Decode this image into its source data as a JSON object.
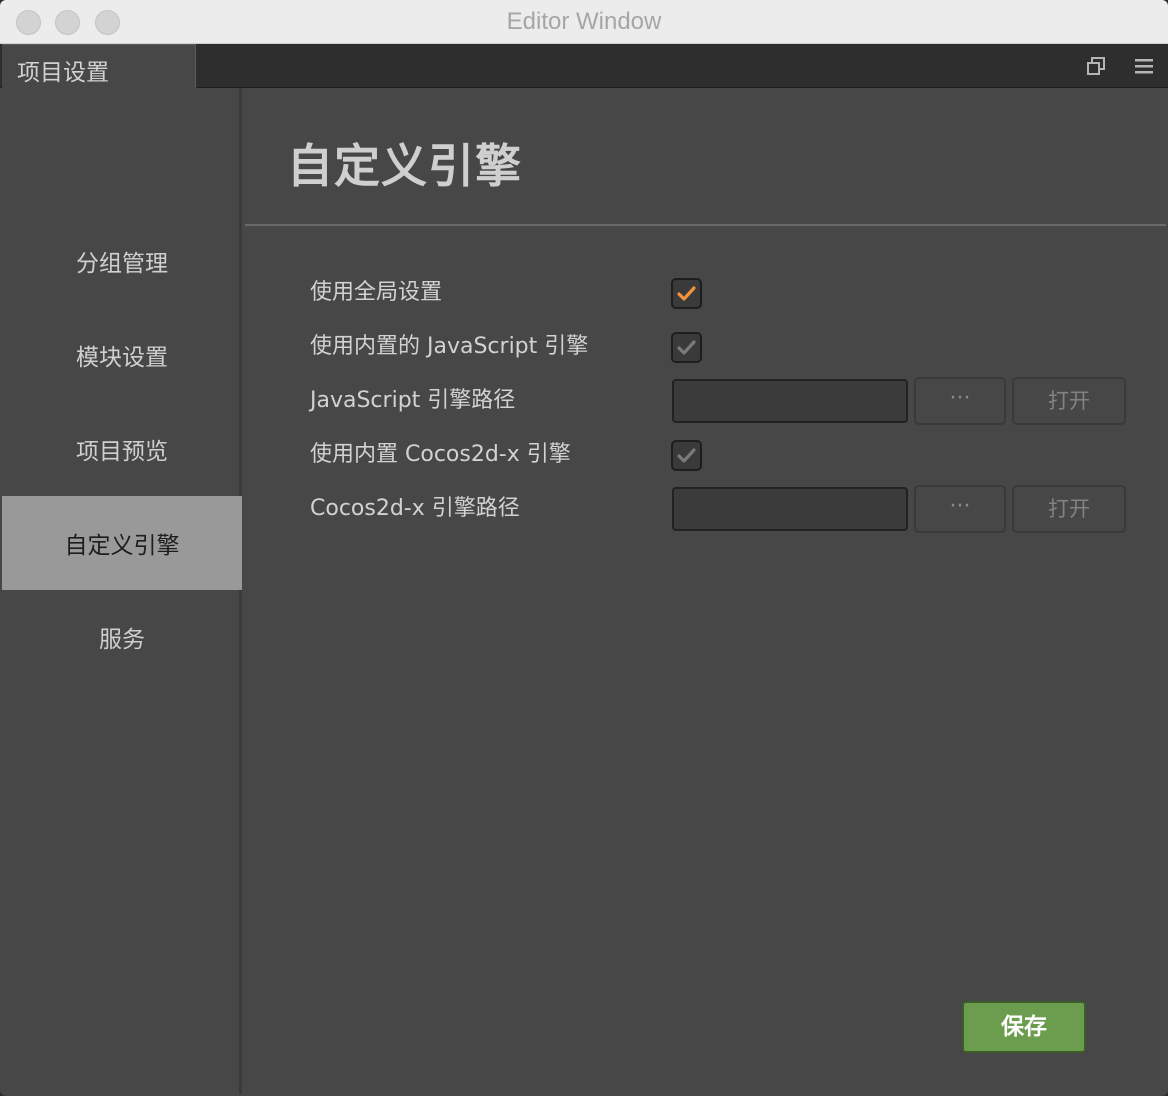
{
  "window": {
    "title": "Editor Window"
  },
  "tab": {
    "label": "项目设置",
    "popout_icon": "popout-icon",
    "menu_icon": "hamburger-menu-icon"
  },
  "sidebar": {
    "items": [
      {
        "label": "分组管理",
        "active": false
      },
      {
        "label": "模块设置",
        "active": false
      },
      {
        "label": "项目预览",
        "active": false
      },
      {
        "label": "自定义引擎",
        "active": true
      },
      {
        "label": "服务",
        "active": false
      }
    ]
  },
  "main": {
    "title": "自定义引擎",
    "rows": [
      {
        "label": "使用全局设置",
        "type": "checkbox",
        "checked": true,
        "check_color": "#f0933b"
      },
      {
        "label": "使用内置的 JavaScript 引擎",
        "type": "checkbox",
        "checked": true,
        "check_color": "#7a7a7a"
      },
      {
        "label": "JavaScript 引擎路径",
        "type": "path",
        "value": "",
        "browse_label": "···",
        "open_label": "打开"
      },
      {
        "label": "使用内置 Cocos2d-x 引擎",
        "type": "checkbox",
        "checked": true,
        "check_color": "#7a7a7a"
      },
      {
        "label": "Cocos2d-x 引擎路径",
        "type": "path",
        "value": "",
        "browse_label": "···",
        "open_label": "打开"
      }
    ],
    "save_label": "保存"
  },
  "colors": {
    "accent_check": "#f0933b",
    "save_green": "#6c9c4d",
    "active_nav": "#999999"
  }
}
